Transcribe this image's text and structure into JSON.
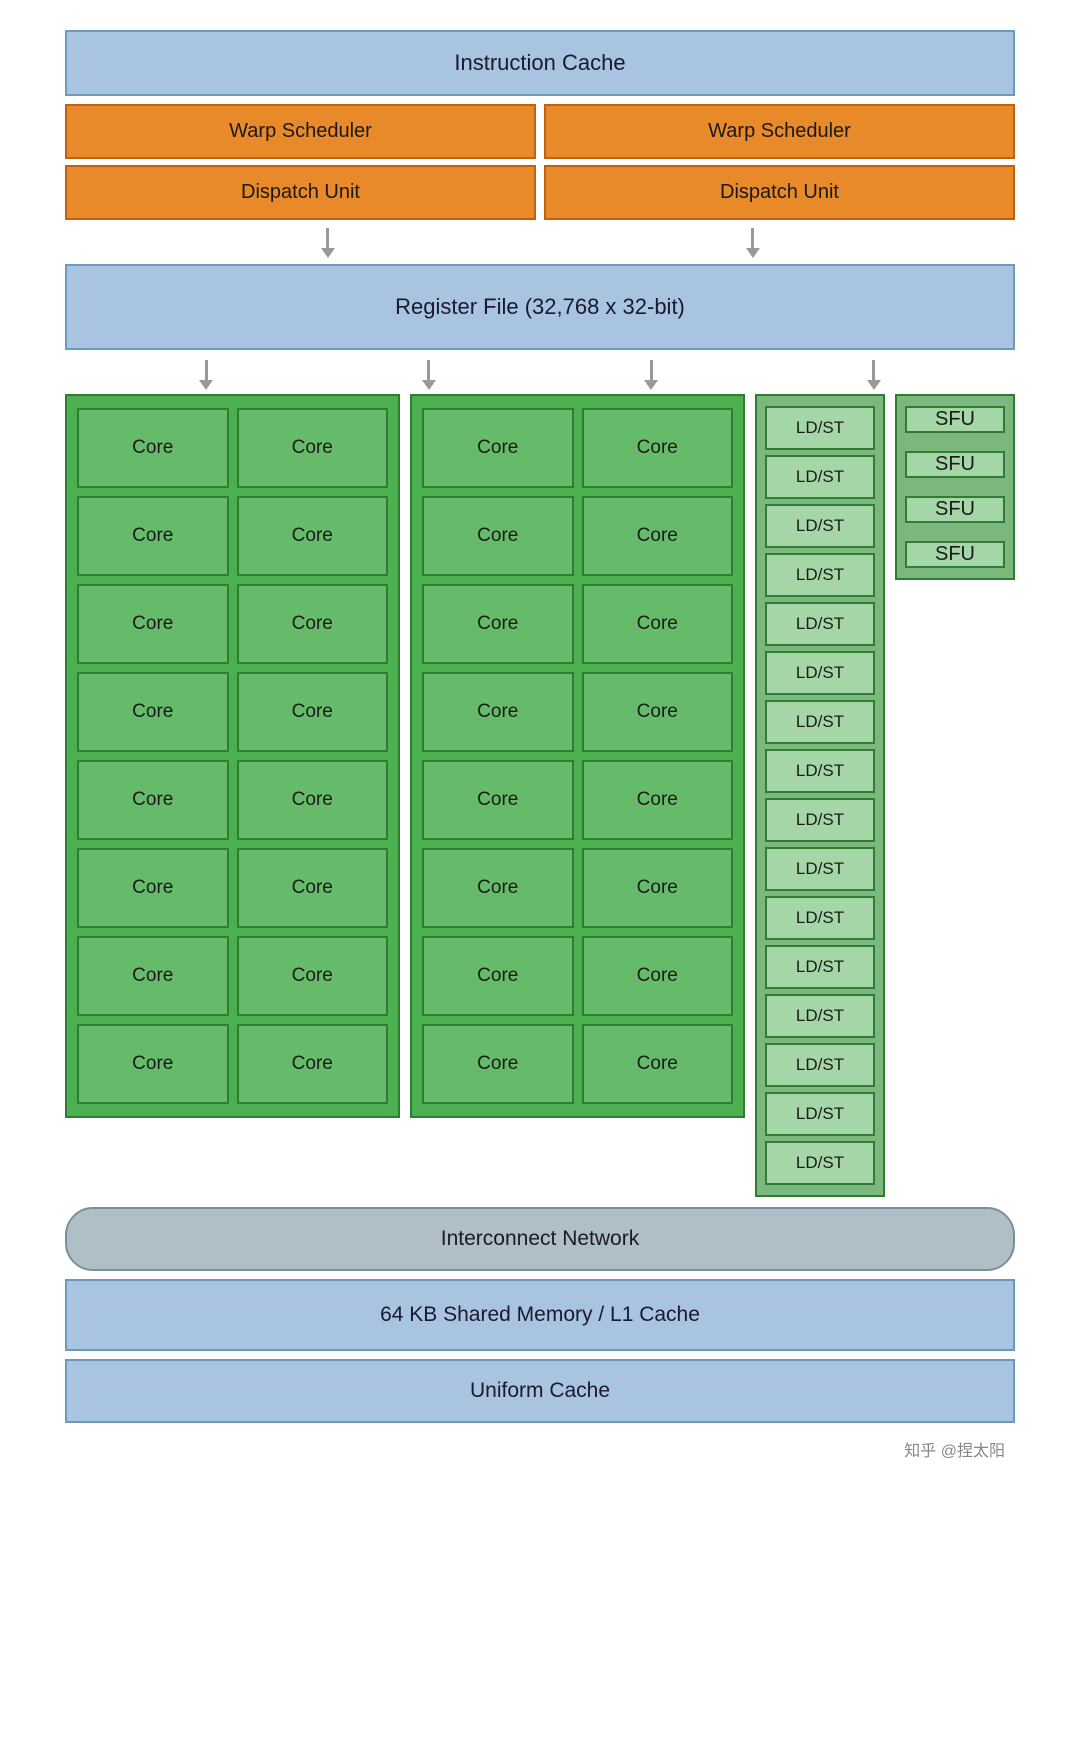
{
  "diagram": {
    "instruction_cache": "Instruction Cache",
    "warp_scheduler_1": "Warp Scheduler",
    "warp_scheduler_2": "Warp Scheduler",
    "dispatch_unit_1": "Dispatch Unit",
    "dispatch_unit_2": "Dispatch Unit",
    "register_file": "Register File (32,768 x 32-bit)",
    "core_label": "Core",
    "ldst_label": "LD/ST",
    "sfu_label": "SFU",
    "interconnect": "Interconnect Network",
    "shared_memory": "64 KB Shared Memory / L1 Cache",
    "uniform_cache": "Uniform Cache",
    "watermark": "知乎 @捏太阳"
  }
}
